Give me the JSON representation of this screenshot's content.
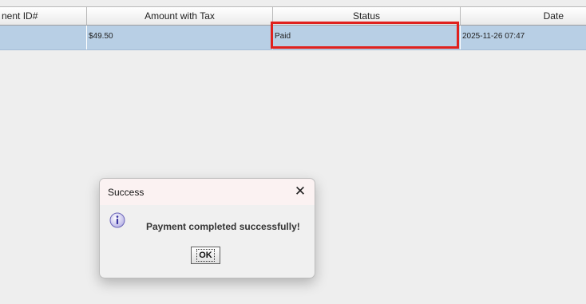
{
  "table": {
    "columns": [
      "nent ID#",
      "Amount with Tax",
      "Status",
      "Date"
    ],
    "rows": [
      {
        "payment_id": "",
        "amount": "$49.50",
        "status": "Paid",
        "date": "2025-11-26 07:47"
      }
    ]
  },
  "dialog": {
    "title": "Success",
    "message": "Payment completed successfully!",
    "ok_label": "OK",
    "close_glyph": "✕"
  },
  "colors": {
    "selected_row": "#b8cfe5",
    "highlight_border": "#e0211e",
    "background": "#eeeeee"
  }
}
